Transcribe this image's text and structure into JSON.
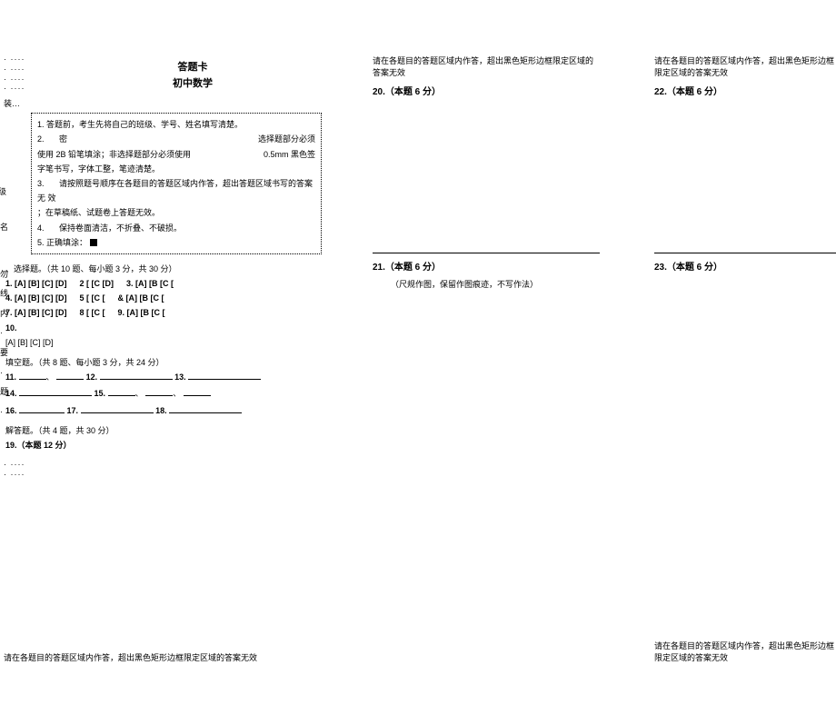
{
  "title": "答题卡",
  "subtitle": "初中数学",
  "decor": "装…",
  "side_labels": [
    "级",
    "",
    "",
    "",
    "名",
    "",
    "",
    "",
    "",
    ":",
    ":"
  ],
  "dots4": "·   ····",
  "instructions": {
    "l1_left": "1.",
    "l1_right": "答题前，考生先将自己的班级、学号、姓名填写清楚。",
    "l2_num": "2.",
    "l2_a": "使用 2B 铅笔填涂；非选择题部分必须使用",
    "l2_pre": "密",
    "l2_r1": "选择题部分必须",
    "l2_r2": "0.5mm 黑色签",
    "l2_tail": "字笔书写，字体工整，笔迹清楚。",
    "l3_num": "3.",
    "l3": "请按照题号顺序在各题目的答题区域内作答，超出答题区域书写的答案无   效",
    "l3_tail": "；在草稿纸、试题卷上答题无效。",
    "l4_num": "4.",
    "l4": "保持卷面清洁，不折叠、不破损。",
    "l5_label": "5. 正确填涂：",
    "l5_sym": "■"
  },
  "part1": {
    "heading": "、选择题。（共 10 题、每小题 3 分，共 30 分）",
    "row1": [
      "1. [A] [B] [C] [D]",
      "2  [   [C   [D]",
      "3. [A]  [B   [C   ["
    ],
    "row2": [
      "4. [A] [B] [C] [D]",
      "5  [   [C   [",
      "&  [A]  [B   [C   ["
    ],
    "row3": [
      "7. [A] [B] [C] [D]",
      "8  [   [C   [",
      "9. [A]  [B   [C   ["
    ],
    "row4": "10.",
    "row4b": "[A] [B] [C] [D]"
  },
  "part2": {
    "pre": "勿\n线\n内\n·\n要\n·\n题",
    "heading": "填空题。（共 8 题、每小题 3 分，共 24 分）",
    "items": {
      "11": "11.",
      "12": "12.",
      "13": "13.",
      "14": "14.",
      "15": "15.",
      "16": "16.",
      "17": "17.",
      "18": "18."
    }
  },
  "part3": {
    "pre": "·\n线\n·\n·",
    "heading": "解答题。（共 4 题，共 30 分）",
    "q19": "19.（本题 12 分）"
  },
  "dots_tail": [
    "·   ····",
    "·   ····"
  ],
  "colnote": "请在各题目的答题区域内作答，超出黑色矩形边框限定区域的答案无效",
  "q20": "20.（本题 6 分）",
  "q21": "21.（本题 6 分）",
  "q21_sub": "（尺规作图，保留作图痕迹，不写作法）",
  "q22": "22.（本题 6 分）",
  "q23": "23.（本题 6 分）"
}
